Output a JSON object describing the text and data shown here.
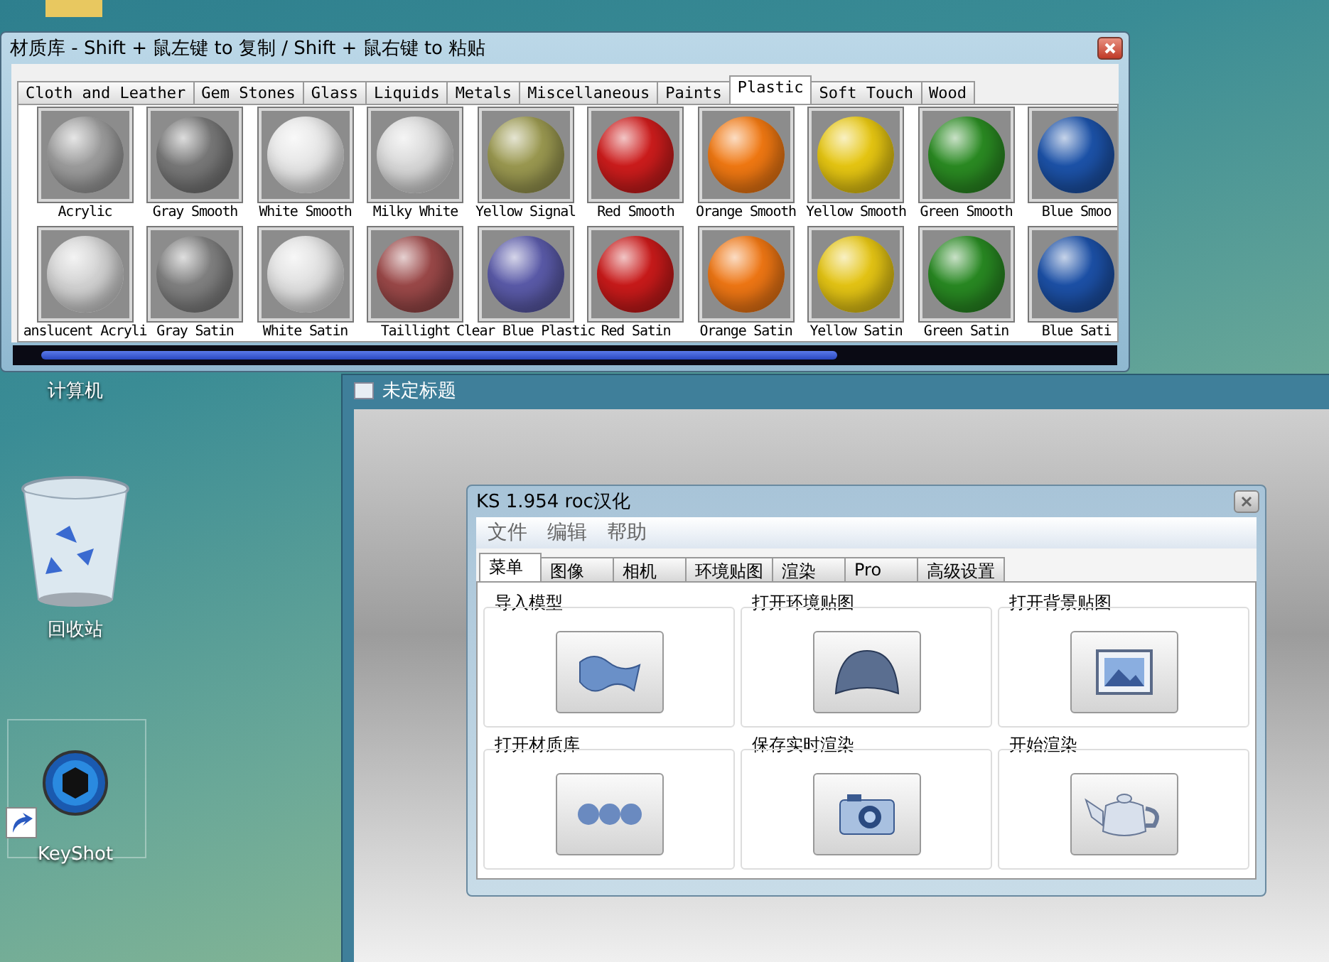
{
  "desktop": {
    "icons": [
      {
        "label": "计算机",
        "kind": "computer"
      },
      {
        "label": "回收站",
        "kind": "recycle"
      },
      {
        "label": "KeyShot",
        "kind": "keyshot"
      }
    ]
  },
  "background_window": {
    "title": "未定标题"
  },
  "material_window": {
    "title": "材质库 - Shift + 鼠左键 to 复制 / Shift + 鼠右键 to 粘贴",
    "tabs": [
      {
        "label": "Cloth and Leather",
        "selected": false
      },
      {
        "label": "Gem Stones",
        "selected": false
      },
      {
        "label": "Glass",
        "selected": false
      },
      {
        "label": "Liquids",
        "selected": false
      },
      {
        "label": "Metals",
        "selected": false
      },
      {
        "label": "Miscellaneous",
        "selected": false
      },
      {
        "label": "Paints",
        "selected": false
      },
      {
        "label": "Plastic",
        "selected": true
      },
      {
        "label": "Soft Touch",
        "selected": false
      },
      {
        "label": "Wood",
        "selected": false
      }
    ],
    "materials": [
      {
        "name": "Acrylic",
        "color": "#9c9c9c"
      },
      {
        "name": "Gray Smooth",
        "color": "#787878"
      },
      {
        "name": "White Smooth",
        "color": "#e6e6e6"
      },
      {
        "name": "Milky White",
        "color": "#d8d8d8"
      },
      {
        "name": "Yellow Signal",
        "color": "#9a9850"
      },
      {
        "name": "Red Smooth",
        "color": "#cc1c1c"
      },
      {
        "name": "Orange Smooth",
        "color": "#f07812"
      },
      {
        "name": "Yellow Smooth",
        "color": "#e6c612"
      },
      {
        "name": "Green Smooth",
        "color": "#2a8a22"
      },
      {
        "name": "Blue Smoo",
        "color": "#1c52a8"
      },
      {
        "name": "anslucent Acryli",
        "color": "#d2d2d2"
      },
      {
        "name": "Gray Satin",
        "color": "#808080"
      },
      {
        "name": "White Satin",
        "color": "#e0e0e0"
      },
      {
        "name": "Taillight",
        "color": "#9a4848"
      },
      {
        "name": "Clear Blue Plastic",
        "color": "#5a5aa8"
      },
      {
        "name": "Red Satin",
        "color": "#c81a1a"
      },
      {
        "name": "Orange Satin",
        "color": "#ee7614"
      },
      {
        "name": "Yellow Satin",
        "color": "#e4c414"
      },
      {
        "name": "Green Satin",
        "color": "#288822"
      },
      {
        "name": "Blue Sati",
        "color": "#1c50a6"
      }
    ]
  },
  "ks_window": {
    "title": "KS 1.954 roc汉化",
    "menu": [
      "文件",
      "编辑",
      "帮助"
    ],
    "tabs": [
      {
        "label": "菜单",
        "selected": true
      },
      {
        "label": "图像",
        "selected": false
      },
      {
        "label": "相机",
        "selected": false
      },
      {
        "label": "环境贴图",
        "selected": false
      },
      {
        "label": "渲染",
        "selected": false
      },
      {
        "label": "Pro",
        "selected": false
      },
      {
        "label": "高级设置",
        "selected": false
      }
    ],
    "actions": [
      {
        "label": "导入模型",
        "kind": "import"
      },
      {
        "label": "打开环境贴图",
        "kind": "environment"
      },
      {
        "label": "打开背景贴图",
        "kind": "background"
      },
      {
        "label": "打开材质库",
        "kind": "materials"
      },
      {
        "label": "保存实时渲染",
        "kind": "save"
      },
      {
        "label": "开始渲染",
        "kind": "render"
      }
    ]
  }
}
